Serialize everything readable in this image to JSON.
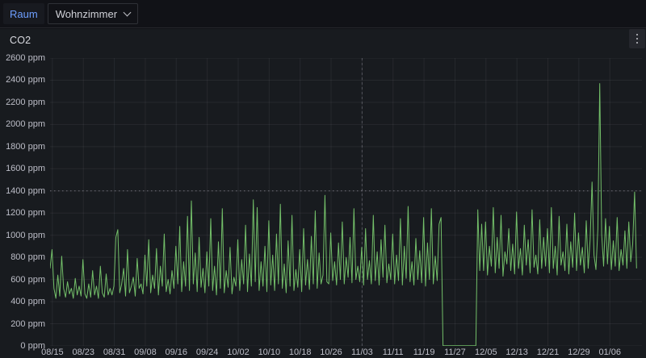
{
  "topbar": {
    "variable_label": "Raum",
    "variable_value": "Wohnzimmer"
  },
  "panel": {
    "title": "CO2"
  },
  "icons": {
    "dropdown_chevron": "chevron-down",
    "panel_menu": "kebab-vertical-dots"
  },
  "colors": {
    "page_bg": "#111217",
    "panel_bg": "#181b1f",
    "series_green": "#73BF69",
    "grid": "rgba(204,204,220,0.08)",
    "axis_text": "#bdbec8",
    "threshold_line": "rgba(204,204,220,0.45)",
    "annotation_line": "rgba(204,204,220,0.28)",
    "variable_label_blue": "#6e9fff"
  },
  "chart_data": {
    "type": "line",
    "title": "CO2",
    "unit": "ppm",
    "ylim": [
      0,
      2600
    ],
    "y_tick_step": 200,
    "y_tick_labels": [
      "0 ppm",
      "200 ppm",
      "400 ppm",
      "600 ppm",
      "800 ppm",
      "1000 ppm",
      "1200 ppm",
      "1400 ppm",
      "1600 ppm",
      "1800 ppm",
      "2000 ppm",
      "2200 ppm",
      "2400 ppm",
      "2600 ppm"
    ],
    "x_ticks": [
      "08/15",
      "08/23",
      "08/31",
      "09/08",
      "09/16",
      "09/24",
      "10/02",
      "10/10",
      "10/18",
      "10/26",
      "11/03",
      "11/11",
      "11/19",
      "11/27",
      "12/05",
      "12/13",
      "12/21",
      "12/29",
      "01/06"
    ],
    "x_tick_interval_days": 8,
    "grid": true,
    "legend": "none",
    "threshold": {
      "value_ppm": 1400,
      "style": "dotted"
    },
    "annotation_vline": {
      "day_offset": 80,
      "near_tick": "11/03",
      "style": "dashed"
    },
    "gap_to_zero": {
      "from_day": 101.5,
      "to_day": 110,
      "value": 0
    },
    "series": [
      {
        "name": "CO2 Wohnzimmer",
        "color": "#73BF69",
        "start_day": -0.6,
        "step_days": 0.5,
        "values": [
          700,
          870,
          520,
          430,
          640,
          450,
          810,
          520,
          440,
          580,
          470,
          520,
          430,
          610,
          460,
          540,
          450,
          780,
          470,
          430,
          560,
          440,
          680,
          460,
          540,
          430,
          720,
          480,
          440,
          650,
          460,
          520,
          460,
          540,
          980,
          1050,
          480,
          560,
          700,
          450,
          870,
          480,
          540,
          620,
          450,
          790,
          520,
          560,
          470,
          820,
          540,
          960,
          480,
          640,
          520,
          880,
          460,
          720,
          540,
          1010,
          490,
          600,
          470,
          680,
          520,
          900,
          560,
          1080,
          490,
          760,
          540,
          1170,
          500,
          1310,
          560,
          840,
          490,
          980,
          530,
          700,
          480,
          850,
          540,
          1150,
          500,
          720,
          460,
          940,
          520,
          1240,
          480,
          680,
          530,
          890,
          470,
          620,
          540,
          960,
          500,
          780,
          560,
          1090,
          490,
          830,
          540,
          1320,
          580,
          1250,
          500,
          760,
          540,
          900,
          490,
          1130,
          550,
          820,
          500,
          1010,
          560,
          1280,
          520,
          740,
          480,
          950,
          540,
          1180,
          500,
          690,
          530,
          870,
          490,
          1060,
          550,
          780,
          510,
          990,
          560,
          1220,
          520,
          840,
          560,
          640,
          1360,
          580,
          560,
          1020,
          590,
          760,
          550,
          930,
          600,
          1120,
          560,
          800,
          620,
          980,
          570,
          1240,
          600,
          720,
          580,
          890,
          550,
          1060,
          600,
          770,
          560,
          1180,
          590,
          850,
          550,
          960,
          620,
          1090,
          570,
          740,
          600,
          1010,
          560,
          820,
          590,
          1150,
          550,
          900,
          610,
          1260,
          580,
          760,
          550,
          970,
          600,
          860,
          570,
          1160,
          540,
          930,
          600,
          1240,
          560,
          810,
          590,
          1100,
          1160,
          2,
          2,
          2,
          2,
          2,
          2,
          2,
          2,
          2,
          2,
          2,
          2,
          2,
          2,
          2,
          2,
          2,
          2,
          1230,
          680,
          1100,
          680,
          1120,
          640,
          900,
          720,
          1250,
          660,
          980,
          700,
          1180,
          630,
          850,
          740,
          1060,
          680,
          920,
          650,
          1210,
          700,
          880,
          640,
          1090,
          730,
          960,
          660,
          1230,
          710,
          820,
          650,
          1140,
          700,
          980,
          720,
          1060,
          660,
          1250,
          700,
          900,
          640,
          1170,
          730,
          850,
          680,
          1100,
          650,
          940,
          710,
          1200,
          680,
          1020,
          730,
          890,
          660,
          1130,
          700,
          960,
          1480,
          820,
          690,
          1060,
          2370,
          1010,
          720,
          1150,
          740,
          1080,
          690,
          950,
          720,
          1160,
          680,
          870,
          730,
          1040,
          700,
          1120,
          760,
          920,
          1390,
          700
        ]
      }
    ]
  }
}
